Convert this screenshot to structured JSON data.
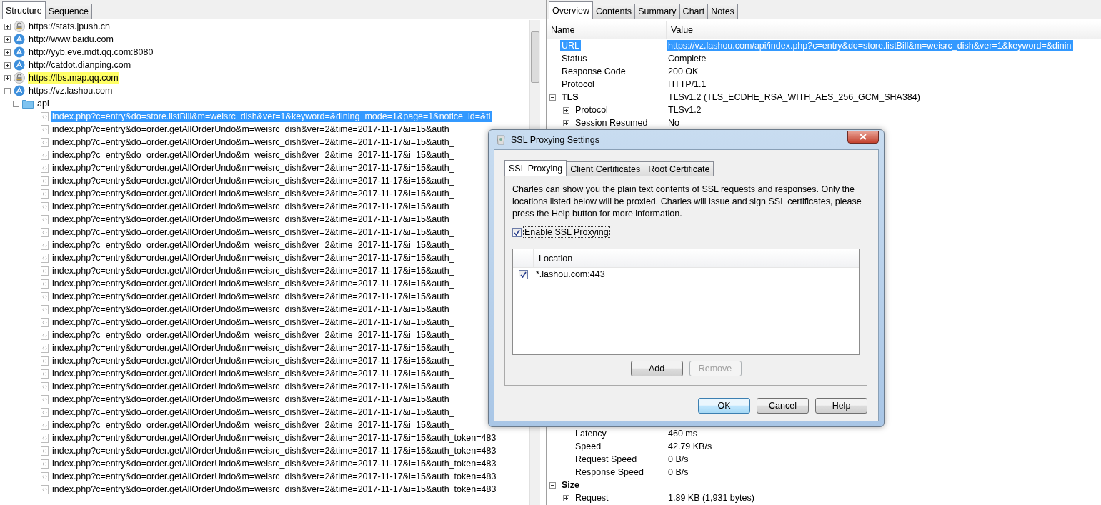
{
  "structure": {
    "tabs": [
      {
        "label": "Structure",
        "selected": true
      },
      {
        "label": "Sequence",
        "selected": false
      }
    ],
    "hosts": [
      {
        "label": "https://stats.jpush.cn",
        "kind": "lock",
        "expanded": false,
        "highlighted": false
      },
      {
        "label": "http://www.baidu.com",
        "kind": "globe",
        "expanded": false,
        "highlighted": false
      },
      {
        "label": "http://yyb.eve.mdt.qq.com:8080",
        "kind": "globe",
        "expanded": false,
        "highlighted": false
      },
      {
        "label": "http://catdot.dianping.com",
        "kind": "globe",
        "expanded": false,
        "highlighted": false
      },
      {
        "label": "https://lbs.map.qq.com",
        "kind": "lock",
        "expanded": false,
        "highlighted": true
      },
      {
        "label": "https://vz.lashou.com",
        "kind": "globe",
        "expanded": true,
        "highlighted": false,
        "children": [
          {
            "label": "api",
            "expanded": true,
            "children": [
              {
                "label": "index.php?c=entry&do=store.listBill&m=weisrc_dish&ver=1&keyword=&dining_mode=1&page=1&notice_id=&ti",
                "selected": true
              },
              {
                "label": "index.php?c=entry&do=order.getAllOrderUndo&m=weisrc_dish&ver=2&time=2017-11-17&i=15&auth_",
                "selected": false
              },
              {
                "label": "index.php?c=entry&do=order.getAllOrderUndo&m=weisrc_dish&ver=2&time=2017-11-17&i=15&auth_",
                "selected": false
              },
              {
                "label": "index.php?c=entry&do=order.getAllOrderUndo&m=weisrc_dish&ver=2&time=2017-11-17&i=15&auth_",
                "selected": false
              },
              {
                "label": "index.php?c=entry&do=order.getAllOrderUndo&m=weisrc_dish&ver=2&time=2017-11-17&i=15&auth_",
                "selected": false
              },
              {
                "label": "index.php?c=entry&do=order.getAllOrderUndo&m=weisrc_dish&ver=2&time=2017-11-17&i=15&auth_",
                "selected": false
              },
              {
                "label": "index.php?c=entry&do=order.getAllOrderUndo&m=weisrc_dish&ver=2&time=2017-11-17&i=15&auth_",
                "selected": false
              },
              {
                "label": "index.php?c=entry&do=order.getAllOrderUndo&m=weisrc_dish&ver=2&time=2017-11-17&i=15&auth_",
                "selected": false
              },
              {
                "label": "index.php?c=entry&do=order.getAllOrderUndo&m=weisrc_dish&ver=2&time=2017-11-17&i=15&auth_",
                "selected": false
              },
              {
                "label": "index.php?c=entry&do=order.getAllOrderUndo&m=weisrc_dish&ver=2&time=2017-11-17&i=15&auth_",
                "selected": false
              },
              {
                "label": "index.php?c=entry&do=order.getAllOrderUndo&m=weisrc_dish&ver=2&time=2017-11-17&i=15&auth_",
                "selected": false
              },
              {
                "label": "index.php?c=entry&do=order.getAllOrderUndo&m=weisrc_dish&ver=2&time=2017-11-17&i=15&auth_",
                "selected": false
              },
              {
                "label": "index.php?c=entry&do=order.getAllOrderUndo&m=weisrc_dish&ver=2&time=2017-11-17&i=15&auth_",
                "selected": false
              },
              {
                "label": "index.php?c=entry&do=order.getAllOrderUndo&m=weisrc_dish&ver=2&time=2017-11-17&i=15&auth_",
                "selected": false
              },
              {
                "label": "index.php?c=entry&do=order.getAllOrderUndo&m=weisrc_dish&ver=2&time=2017-11-17&i=15&auth_",
                "selected": false
              },
              {
                "label": "index.php?c=entry&do=order.getAllOrderUndo&m=weisrc_dish&ver=2&time=2017-11-17&i=15&auth_",
                "selected": false
              },
              {
                "label": "index.php?c=entry&do=order.getAllOrderUndo&m=weisrc_dish&ver=2&time=2017-11-17&i=15&auth_",
                "selected": false
              },
              {
                "label": "index.php?c=entry&do=order.getAllOrderUndo&m=weisrc_dish&ver=2&time=2017-11-17&i=15&auth_",
                "selected": false
              },
              {
                "label": "index.php?c=entry&do=order.getAllOrderUndo&m=weisrc_dish&ver=2&time=2017-11-17&i=15&auth_",
                "selected": false
              },
              {
                "label": "index.php?c=entry&do=order.getAllOrderUndo&m=weisrc_dish&ver=2&time=2017-11-17&i=15&auth_",
                "selected": false
              },
              {
                "label": "index.php?c=entry&do=order.getAllOrderUndo&m=weisrc_dish&ver=2&time=2017-11-17&i=15&auth_",
                "selected": false
              },
              {
                "label": "index.php?c=entry&do=order.getAllOrderUndo&m=weisrc_dish&ver=2&time=2017-11-17&i=15&auth_",
                "selected": false
              },
              {
                "label": "index.php?c=entry&do=order.getAllOrderUndo&m=weisrc_dish&ver=2&time=2017-11-17&i=15&auth_",
                "selected": false
              },
              {
                "label": "index.php?c=entry&do=order.getAllOrderUndo&m=weisrc_dish&ver=2&time=2017-11-17&i=15&auth_",
                "selected": false
              },
              {
                "label": "index.php?c=entry&do=order.getAllOrderUndo&m=weisrc_dish&ver=2&time=2017-11-17&i=15&auth_",
                "selected": false
              },
              {
                "label": "index.php?c=entry&do=order.getAllOrderUndo&m=weisrc_dish&ver=2&time=2017-11-17&i=15&auth_token=483",
                "selected": false
              },
              {
                "label": "index.php?c=entry&do=order.getAllOrderUndo&m=weisrc_dish&ver=2&time=2017-11-17&i=15&auth_token=483",
                "selected": false
              },
              {
                "label": "index.php?c=entry&do=order.getAllOrderUndo&m=weisrc_dish&ver=2&time=2017-11-17&i=15&auth_token=483",
                "selected": false
              },
              {
                "label": "index.php?c=entry&do=order.getAllOrderUndo&m=weisrc_dish&ver=2&time=2017-11-17&i=15&auth_token=483",
                "selected": false
              },
              {
                "label": "index.php?c=entry&do=order.getAllOrderUndo&m=weisrc_dish&ver=2&time=2017-11-17&i=15&auth_token=483",
                "selected": false
              }
            ]
          }
        ]
      }
    ]
  },
  "overview": {
    "tabs": [
      {
        "label": "Overview",
        "selected": true
      },
      {
        "label": "Contents",
        "selected": false
      },
      {
        "label": "Summary",
        "selected": false
      },
      {
        "label": "Chart",
        "selected": false
      },
      {
        "label": "Notes",
        "selected": false
      }
    ],
    "columns": [
      "Name",
      "Value"
    ],
    "rows_top": [
      {
        "name": "URL",
        "value": "https://vz.lashou.com/api/index.php?c=entry&do=store.listBill&m=weisrc_dish&ver=1&keyword=&dinin",
        "selected": true
      },
      {
        "name": "Status",
        "value": "Complete",
        "selected": false
      },
      {
        "name": "Response Code",
        "value": "200 OK",
        "selected": false
      },
      {
        "name": "Protocol",
        "value": "HTTP/1.1",
        "selected": false
      },
      {
        "name": "TLS",
        "value": "TLSv1.2 (TLS_ECDHE_RSA_WITH_AES_256_GCM_SHA384)",
        "selected": false,
        "expanded": true,
        "children": [
          {
            "name": "Protocol",
            "value": "TLSv1.2",
            "selected": false,
            "expanded": false
          },
          {
            "name": "Session Resumed",
            "value": "No",
            "selected": false,
            "expanded": false
          }
        ]
      }
    ],
    "rows_bottom": [
      {
        "name": "Latency",
        "value": "460 ms",
        "selected": false
      },
      {
        "name": "Speed",
        "value": "42.79 KB/s",
        "selected": false
      },
      {
        "name": "Request Speed",
        "value": "0 B/s",
        "selected": false
      },
      {
        "name": "Response Speed",
        "value": "0 B/s",
        "selected": false
      }
    ],
    "rows_end": [
      {
        "name": "Size",
        "selected": false,
        "expanded": true,
        "children": [
          {
            "name": "Request",
            "value": "1.89 KB (1,931 bytes)",
            "selected": false,
            "expanded": false
          }
        ]
      }
    ]
  },
  "dialog": {
    "title": "SSL Proxying Settings",
    "tabs": [
      {
        "label": "SSL Proxying",
        "selected": true
      },
      {
        "label": "Client Certificates",
        "selected": false
      },
      {
        "label": "Root Certificate",
        "selected": false
      }
    ],
    "description": "Charles can show you the plain text contents of SSL requests and responses. Only the locations listed below will be proxied. Charles will issue and sign SSL certificates, please press the Help button for more information.",
    "enable": {
      "label": "Enable SSL Proxying",
      "checked": true
    },
    "column": "Location",
    "locations": [
      {
        "location": "*.lashou.com:443",
        "checked": true
      }
    ],
    "list_buttons": [
      {
        "label": "Add",
        "disabled": false
      },
      {
        "label": "Remove",
        "disabled": true
      }
    ],
    "buttons": [
      {
        "label": "OK",
        "default": true
      },
      {
        "label": "Cancel",
        "default": false
      },
      {
        "label": "Help",
        "default": false
      }
    ]
  }
}
